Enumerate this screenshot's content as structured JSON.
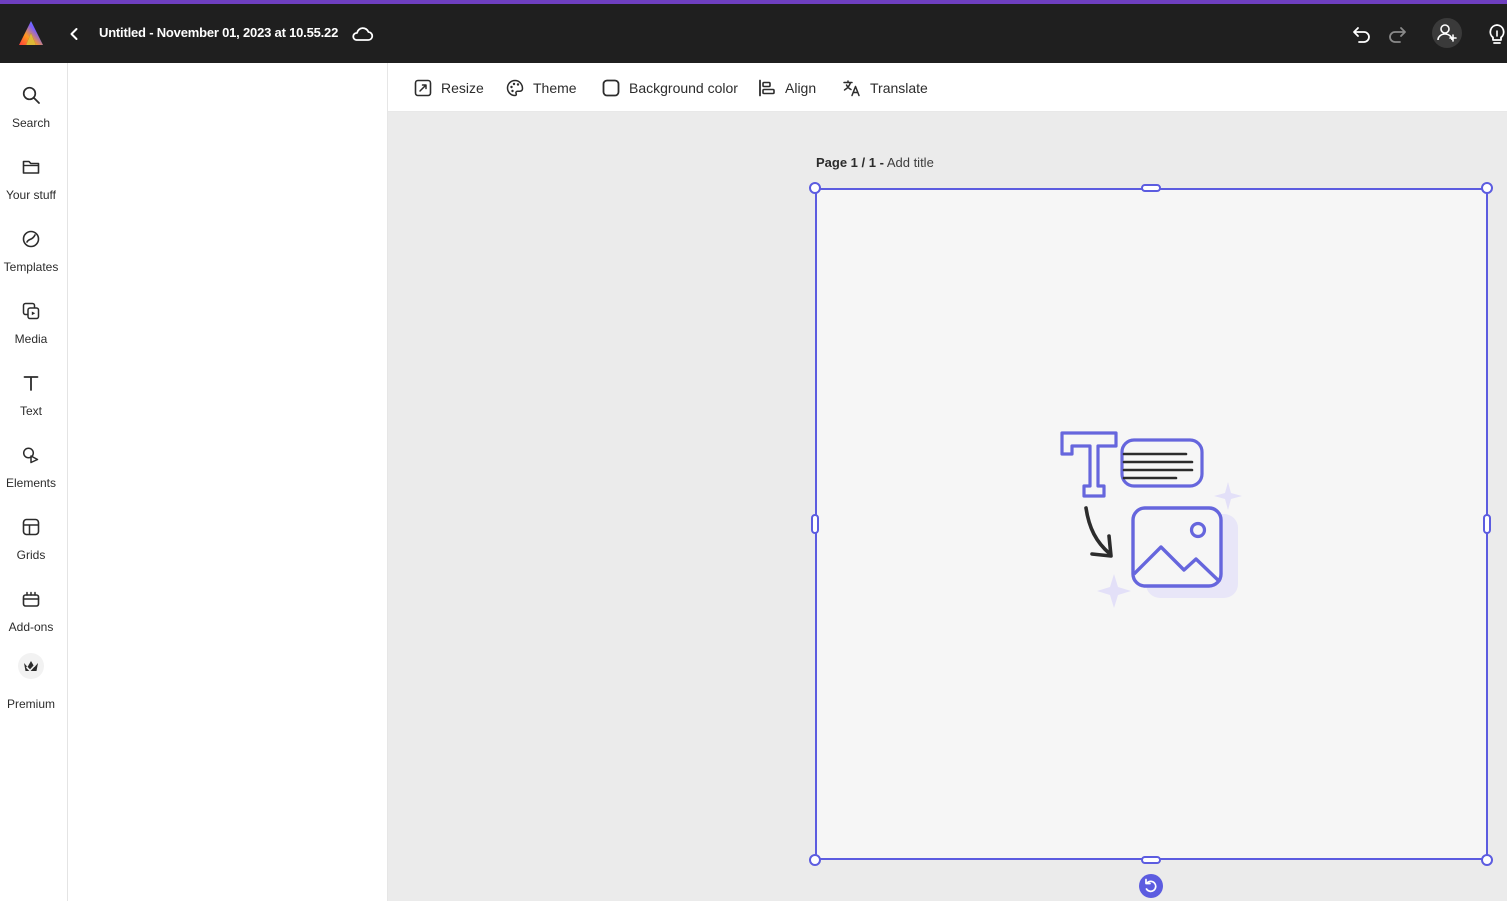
{
  "header": {
    "document_title": "Untitled - November 01, 2023 at 10.55.22",
    "icons": [
      "adobe-express-logo",
      "back-chevron-icon",
      "cloud-icon",
      "undo-icon",
      "redo-icon",
      "invite-icon",
      "bulb-icon"
    ]
  },
  "sidebar": {
    "items": [
      {
        "label": "Search",
        "icon": "search-icon"
      },
      {
        "label": "Your stuff",
        "icon": "folder-icon"
      },
      {
        "label": "Templates",
        "icon": "templates-icon"
      },
      {
        "label": "Media",
        "icon": "media-icon"
      },
      {
        "label": "Text",
        "icon": "text-icon"
      },
      {
        "label": "Elements",
        "icon": "elements-icon"
      },
      {
        "label": "Grids",
        "icon": "grids-icon"
      },
      {
        "label": "Add-ons",
        "icon": "addons-icon"
      },
      {
        "label": "Premium",
        "icon": "premium-icon"
      }
    ]
  },
  "toolbar": {
    "resize": "Resize",
    "theme": "Theme",
    "background_color": "Background color",
    "align": "Align",
    "translate": "Translate"
  },
  "canvas": {
    "page_indicator": "Page 1 / 1 -",
    "page_title_placeholder": "Add title"
  },
  "colors": {
    "topbar": "#1f1f1f",
    "accent_strip": "#6e3fc0",
    "selection": "#5c5ce0",
    "canvas_bg": "#ebebeb",
    "artboard_bg": "#f6f6f6"
  }
}
